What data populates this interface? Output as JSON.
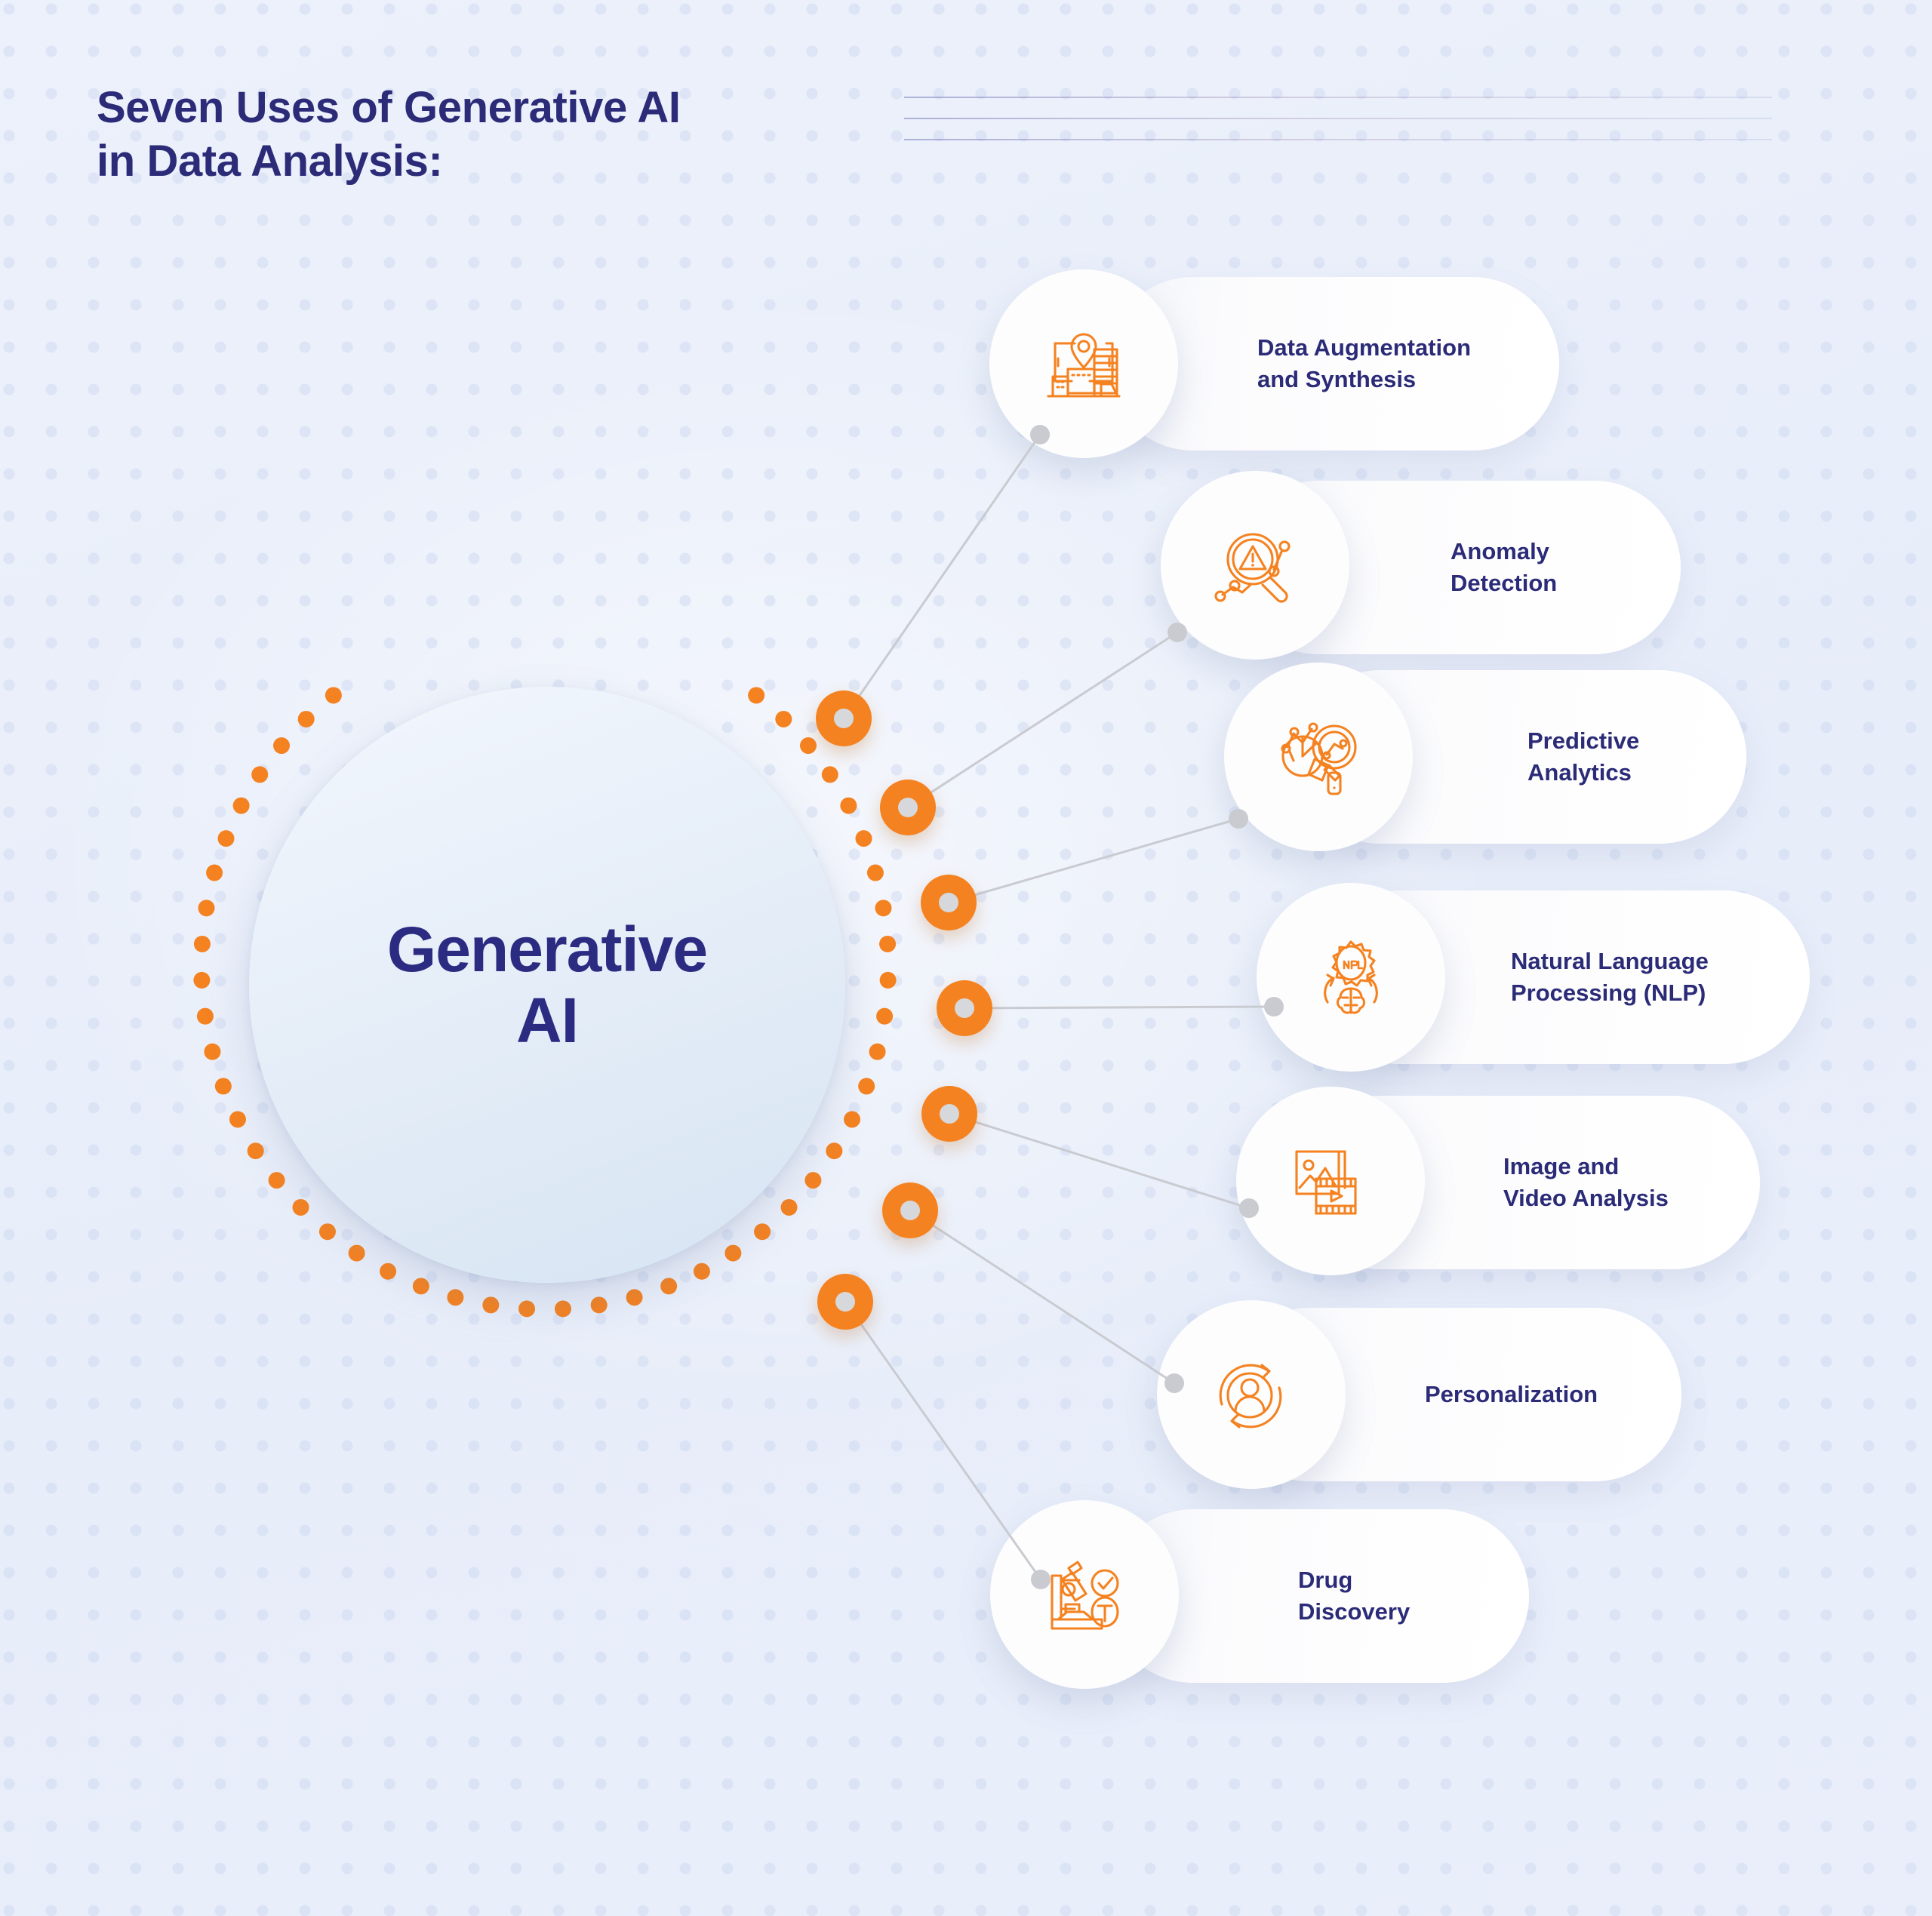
{
  "meta": {
    "accent_orange": "#f58220",
    "navy": "#2b2b78",
    "background": "#eaeffa",
    "connector_gray": "#c9cbd1"
  },
  "header": {
    "title": "Seven Uses of Generative AI\nin Data Analysis:",
    "decorative_rule_count": 3
  },
  "hub": {
    "label": "Generative\nAI",
    "dotted_ring_dot_count": 48,
    "node_count": 7
  },
  "items": [
    {
      "index": 1,
      "label": "Data Augmentation\nand Synthesis",
      "icon": "city-location-pin-icon"
    },
    {
      "index": 2,
      "label": "Anomaly\nDetection",
      "icon": "magnifier-warning-chart-icon"
    },
    {
      "index": 3,
      "label": "Predictive\nAnalytics",
      "icon": "pie-chart-magnifier-icon"
    },
    {
      "index": 4,
      "label": "Natural Language\nProcessing (NLP)",
      "icon": "nlp-gear-brain-icon"
    },
    {
      "index": 5,
      "label": "Image and\nVideo Analysis",
      "icon": "photo-filmstrip-icon"
    },
    {
      "index": 6,
      "label": "Personalization",
      "icon": "user-refresh-cycle-icon"
    },
    {
      "index": 7,
      "label": "Drug\nDiscovery",
      "icon": "microscope-pill-check-icon"
    }
  ]
}
